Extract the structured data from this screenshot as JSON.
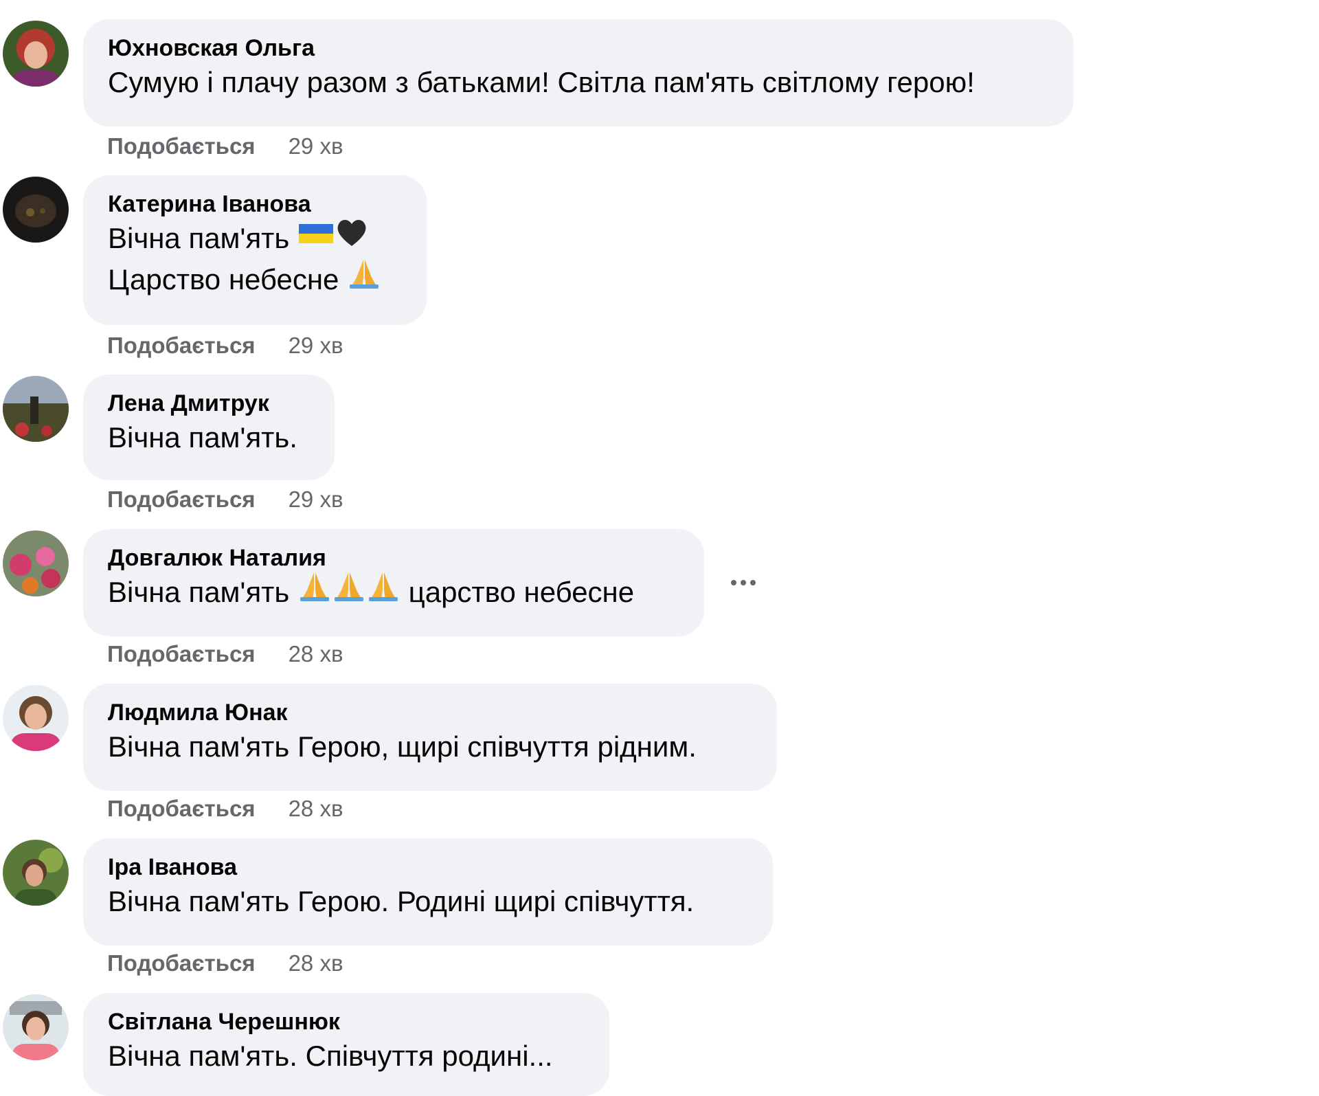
{
  "comments": [
    {
      "author": "Юхновская Ольга",
      "text": "Сумую і плачу разом з батьками! Світла пам'ять світлому герою!",
      "like_label": "Подобається",
      "time": "29 хв"
    },
    {
      "author": "Катерина Іванова",
      "line1": "Вічна пам'ять",
      "line1_emoji": [
        "ukraine-flag-icon",
        "black-heart-icon"
      ],
      "line2": "Царство небесне",
      "line2_emoji": [
        "folded-hands-icon"
      ],
      "like_label": "Подобається",
      "time": "29 хв"
    },
    {
      "author": "Лена Дмитрук",
      "text": "Вічна пам'ять.",
      "like_label": "Подобається",
      "time": "29 хв"
    },
    {
      "author": "Довгалюк Наталия",
      "text_before": "Вічна пам'ять",
      "emoji": [
        "folded-hands-icon",
        "folded-hands-icon",
        "folded-hands-icon"
      ],
      "text_after": "царство небесне",
      "like_label": "Подобається",
      "time": "28 хв"
    },
    {
      "author": "Людмила Юнак",
      "text": "Вічна пам'ять Герою, щирі співчуття рідним.",
      "like_label": "Подобається",
      "time": "28 хв"
    },
    {
      "author": "Іра Іванова",
      "text": "Вічна пам'ять Герою. Родині щирі співчуття.",
      "like_label": "Подобається",
      "time": "28 хв"
    },
    {
      "author": "Світлана Черешнюк",
      "text": "Вічна пам'ять. Співчуття родині...",
      "like_label": "",
      "time": ""
    }
  ],
  "colors": {
    "bubble_bg": "#f0f2f5",
    "secondary_text": "#65676b",
    "primary_text": "#050505"
  }
}
